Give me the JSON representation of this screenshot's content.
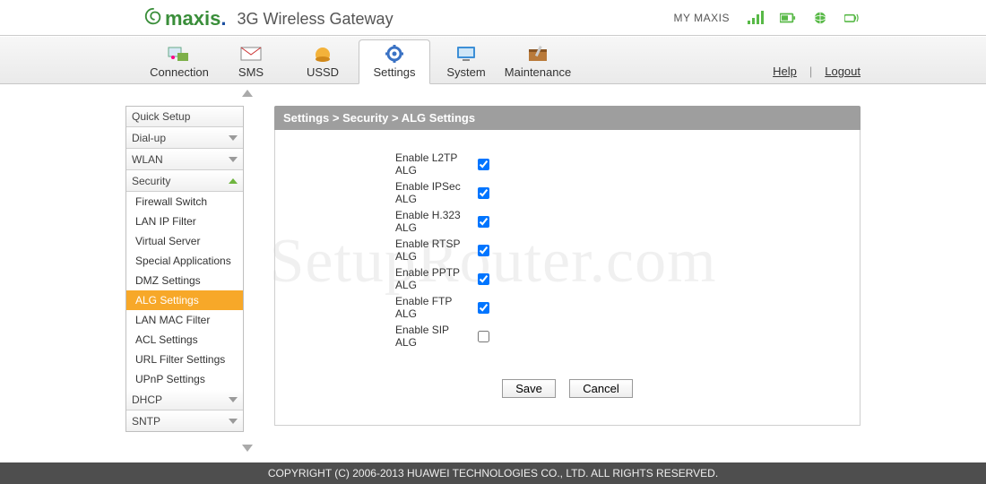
{
  "header": {
    "brand": "maxis",
    "product": "3G Wireless Gateway",
    "my_label": "MY MAXIS"
  },
  "nav": {
    "tabs": [
      {
        "label": "Connection",
        "icon": "connection-icon"
      },
      {
        "label": "SMS",
        "icon": "sms-icon"
      },
      {
        "label": "USSD",
        "icon": "ussd-icon"
      },
      {
        "label": "Settings",
        "icon": "settings-icon",
        "active": true
      },
      {
        "label": "System",
        "icon": "system-icon"
      },
      {
        "label": "Maintenance",
        "icon": "maintenance-icon"
      }
    ],
    "help": "Help",
    "logout": "Logout"
  },
  "sidebar": {
    "groups": [
      {
        "label": "Quick Setup"
      },
      {
        "label": "Dial-up",
        "chev": "down"
      },
      {
        "label": "WLAN",
        "chev": "down"
      },
      {
        "label": "Security",
        "chev": "up",
        "items": [
          "Firewall Switch",
          "LAN IP Filter",
          "Virtual Server",
          "Special Applications",
          "DMZ Settings",
          "ALG Settings",
          "LAN MAC Filter",
          "ACL Settings",
          "URL Filter Settings",
          "UPnP Settings"
        ],
        "active_item": "ALG Settings"
      },
      {
        "label": "DHCP",
        "chev": "down"
      },
      {
        "label": "SNTP",
        "chev": "down"
      }
    ]
  },
  "breadcrumb": "Settings > Security > ALG Settings",
  "alg": {
    "rows": [
      {
        "label": "Enable L2TP ALG",
        "checked": true
      },
      {
        "label": "Enable IPSec ALG",
        "checked": true
      },
      {
        "label": "Enable H.323 ALG",
        "checked": true
      },
      {
        "label": "Enable RTSP ALG",
        "checked": true
      },
      {
        "label": "Enable PPTP ALG",
        "checked": true
      },
      {
        "label": "Enable FTP ALG",
        "checked": true
      },
      {
        "label": "Enable SIP ALG",
        "checked": false
      }
    ],
    "save": "Save",
    "cancel": "Cancel"
  },
  "status_icons": [
    {
      "name": "signal-icon",
      "color": "#58b947"
    },
    {
      "name": "battery-icon",
      "color": "#58b947"
    },
    {
      "name": "globe-icon",
      "color": "#58b947"
    },
    {
      "name": "wifi-icon",
      "color": "#58b947"
    }
  ],
  "footer": "COPYRIGHT (C) 2006-2013 HUAWEI TECHNOLOGIES CO., LTD. ALL RIGHTS RESERVED.",
  "watermark": "SetupRouter.com"
}
